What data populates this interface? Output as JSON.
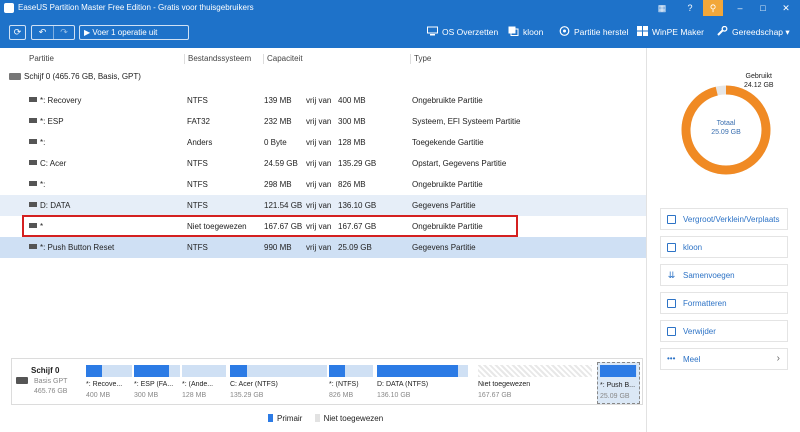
{
  "window": {
    "title": "EaseUS Partition Master Free Edition - Gratis voor thuisgebruikers"
  },
  "titlebar_buttons": [
    "grid-icon",
    "help-icon",
    "key-icon",
    "minimize-icon",
    "maximize-icon",
    "close-icon"
  ],
  "toolbar": {
    "run_label": "Voer 1 operatie uit",
    "items": [
      {
        "label": "OS Overzetten",
        "icon": "os-migrate-icon"
      },
      {
        "label": "kloon",
        "icon": "clone-icon"
      },
      {
        "label": "Partitie herstel",
        "icon": "partition-recovery-icon"
      },
      {
        "label": "WinPE Maker",
        "icon": "windows-icon"
      },
      {
        "label": "Gereedschap",
        "icon": "wrench-icon"
      }
    ]
  },
  "table": {
    "columns": [
      "Partitie",
      "Bestandssysteem",
      "Capaciteit",
      "Type"
    ],
    "disk": "Schijf 0 (465.76 GB, Basis, GPT)",
    "rows": [
      {
        "name": "*: Recovery",
        "fs": "NTFS",
        "used": "139 MB",
        "free_label": "vrij van",
        "total": "400 MB",
        "type": "Ongebruikte Partitie"
      },
      {
        "name": "*: ESP",
        "fs": "FAT32",
        "used": "232 MB",
        "free_label": "vrij van",
        "total": "300 MB",
        "type": "Systeem, EFI Systeem Partitie"
      },
      {
        "name": "*:",
        "fs": "Anders",
        "used": "0 Byte",
        "free_label": "vrij van",
        "total": "128 MB",
        "type": "Toegekende Gartitie"
      },
      {
        "name": "C: Acer",
        "fs": "NTFS",
        "used": "24.59 GB",
        "free_label": "vrij van",
        "total": "135.29 GB",
        "type": "Opstart, Gegevens Partitie"
      },
      {
        "name": "*:",
        "fs": "NTFS",
        "used": "298 MB",
        "free_label": "vrij van",
        "total": "826 MB",
        "type": "Ongebruikte Partitie"
      },
      {
        "name": "D: DATA",
        "fs": "NTFS",
        "used": "121.54 GB",
        "free_label": "vrij van",
        "total": "136.10 GB",
        "type": "Gegevens Partitie"
      },
      {
        "name": "*",
        "fs": "Niet toegewezen",
        "used": "167.67 GB",
        "free_label": "vrij van",
        "total": "167.67 GB",
        "type": "Ongebruikte Partitie"
      },
      {
        "name": "*: Push Button Reset",
        "fs": "NTFS",
        "used": "990 MB",
        "free_label": "vrij van",
        "total": "25.09 GB",
        "type": "Gegevens Partitie"
      }
    ]
  },
  "usage": {
    "used_label": "Gebruikt",
    "used_value": "24.12 GB",
    "total_label": "Totaal",
    "total_value": "25.09 GB",
    "used_fraction": 0.961,
    "colors": {
      "used": "#f08a24",
      "free": "#e6e6e6"
    }
  },
  "actions": [
    {
      "label": "Vergroot/Verklein/Verplaats",
      "icon": "resize-icon"
    },
    {
      "label": "kloon",
      "icon": "clone-icon"
    },
    {
      "label": "Samenvoegen",
      "icon": "merge-icon"
    },
    {
      "label": "Formatteren",
      "icon": "format-icon"
    },
    {
      "label": "Verwijder",
      "icon": "trash-icon"
    },
    {
      "label": "Meel",
      "icon": "more-icon"
    }
  ],
  "diskmap": {
    "disk_name": "Schijf 0",
    "disk_type": "Basis GPT",
    "disk_size": "465.76 GB",
    "partitions": [
      {
        "label": "*: Recove...",
        "size": "400 MB",
        "fill": 0.35
      },
      {
        "label": "*: ESP (FA...",
        "size": "300 MB",
        "fill": 0.77
      },
      {
        "label": "*: (Ande...",
        "size": "128 MB",
        "fill": 0.0
      },
      {
        "label": "C: Acer (NTFS)",
        "size": "135.29 GB",
        "fill": 0.18
      },
      {
        "label": "*: (NTFS)",
        "size": "826 MB",
        "fill": 0.36
      },
      {
        "label": "D: DATA (NTFS)",
        "size": "136.10 GB",
        "fill": 0.89
      },
      {
        "label": "Niet toegewezen",
        "size": "167.67 GB",
        "fill": 0.0
      },
      {
        "label": "*: Push B...",
        "size": "25.09 GB",
        "fill": 0.96
      }
    ]
  },
  "legend": [
    {
      "label": "Primair",
      "color": "#2c7be5"
    },
    {
      "label": "Niet toegewezen",
      "color": "#e2e2e2"
    }
  ],
  "colors": {
    "accent": "#1e72c9",
    "highlight_border": "#d42020",
    "selection": "#cfe0f4"
  }
}
